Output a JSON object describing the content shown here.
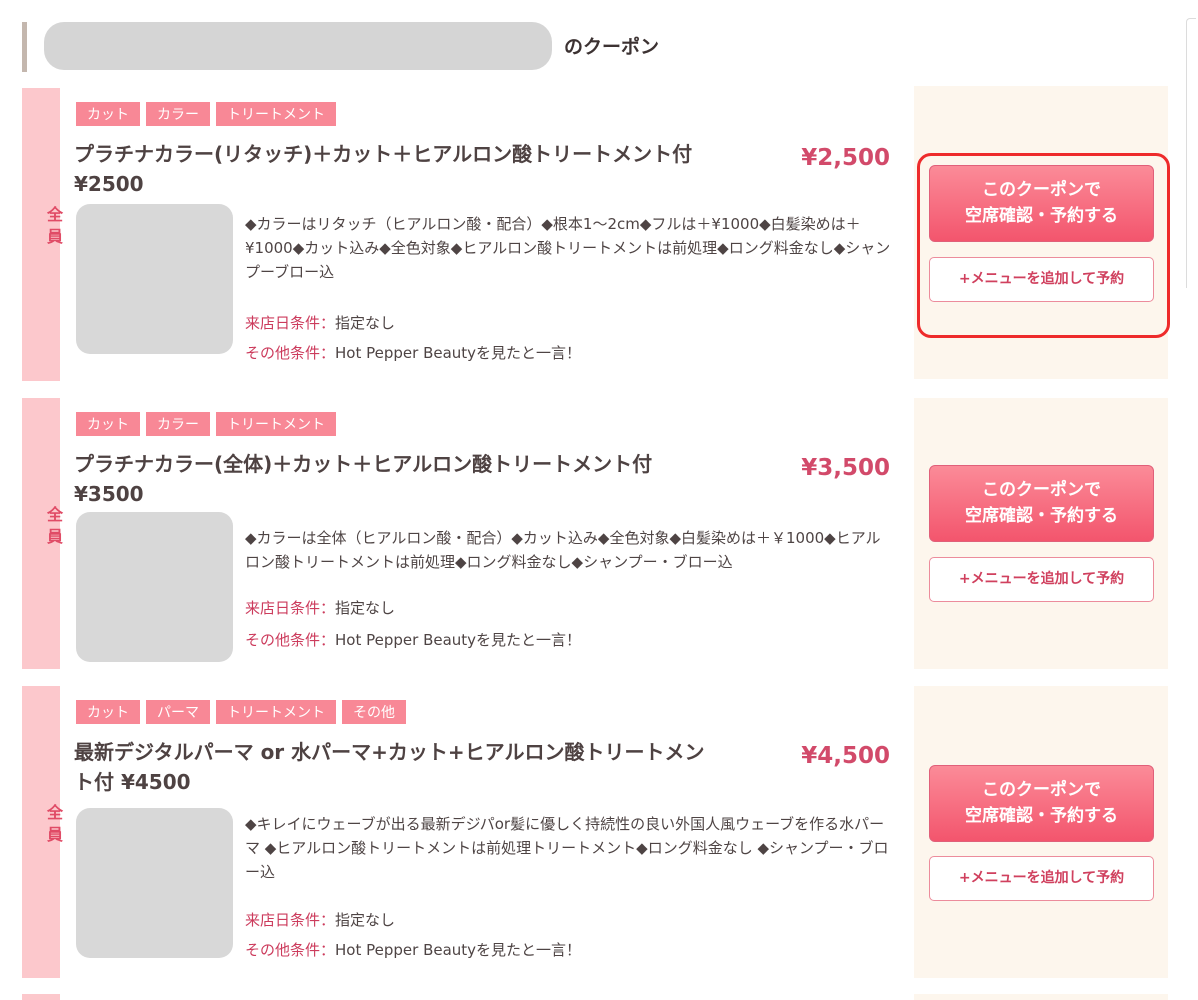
{
  "header": {
    "title": "のクーポン"
  },
  "coupons": [
    {
      "side_label": "全員",
      "tags": [
        "カット",
        "カラー",
        "トリートメント"
      ],
      "title": "プラチナカラー(リタッチ)＋カット＋ヒアルロン酸トリートメント付 ¥2500",
      "price": "¥2,500",
      "description": "◆カラーはリタッチ（ヒアルロン酸・配合）◆根本1～2cm◆フルは＋¥1000◆白髪染めは＋¥1000◆カット込み◆全色対象◆ヒアルロン酸トリートメントは前処理◆ロング料金なし◆シャンプーブロー込",
      "visit_label": "来店日条件：",
      "visit_value": "指定なし",
      "other_label": "その他条件：",
      "other_value": "Hot Pepper Beautyを見たと一言！",
      "book_line1": "このクーポンで",
      "book_line2": "空席確認・予約する",
      "add_label": "+メニューを追加して予約"
    },
    {
      "side_label": "全員",
      "tags": [
        "カット",
        "カラー",
        "トリートメント"
      ],
      "title": "プラチナカラー(全体)＋カット＋ヒアルロン酸トリートメント付 ¥3500",
      "price": "¥3,500",
      "description": "◆カラーは全体（ヒアルロン酸・配合）◆カット込み◆全色対象◆白髪染めは＋￥1000◆ヒアルロン酸トリートメントは前処理◆ロング料金なし◆シャンプー・ブロー込",
      "visit_label": "来店日条件：",
      "visit_value": "指定なし",
      "other_label": "その他条件：",
      "other_value": "Hot Pepper Beautyを見たと一言！",
      "book_line1": "このクーポンで",
      "book_line2": "空席確認・予約する",
      "add_label": "+メニューを追加して予約"
    },
    {
      "side_label": "全員",
      "tags": [
        "カット",
        "パーマ",
        "トリートメント",
        "その他"
      ],
      "title": "最新デジタルパーマ or 水パーマ+カット+ヒアルロン酸トリートメント付 ¥4500",
      "price": "¥4,500",
      "description": "◆キレイにウェーブが出る最新デジパor髪に優しく持続性の良い外国人風ウェーブを作る水パーマ ◆ヒアルロン酸トリートメントは前処理トリートメント◆ロング料金なし ◆シャンプー・ブロー込",
      "visit_label": "来店日条件：",
      "visit_value": "指定なし",
      "other_label": "その他条件：",
      "other_value": "Hot Pepper Beautyを見たと一言！",
      "book_line1": "このクーポンで",
      "book_line2": "空席確認・予約する",
      "add_label": "+メニューを追加して予約"
    }
  ]
}
